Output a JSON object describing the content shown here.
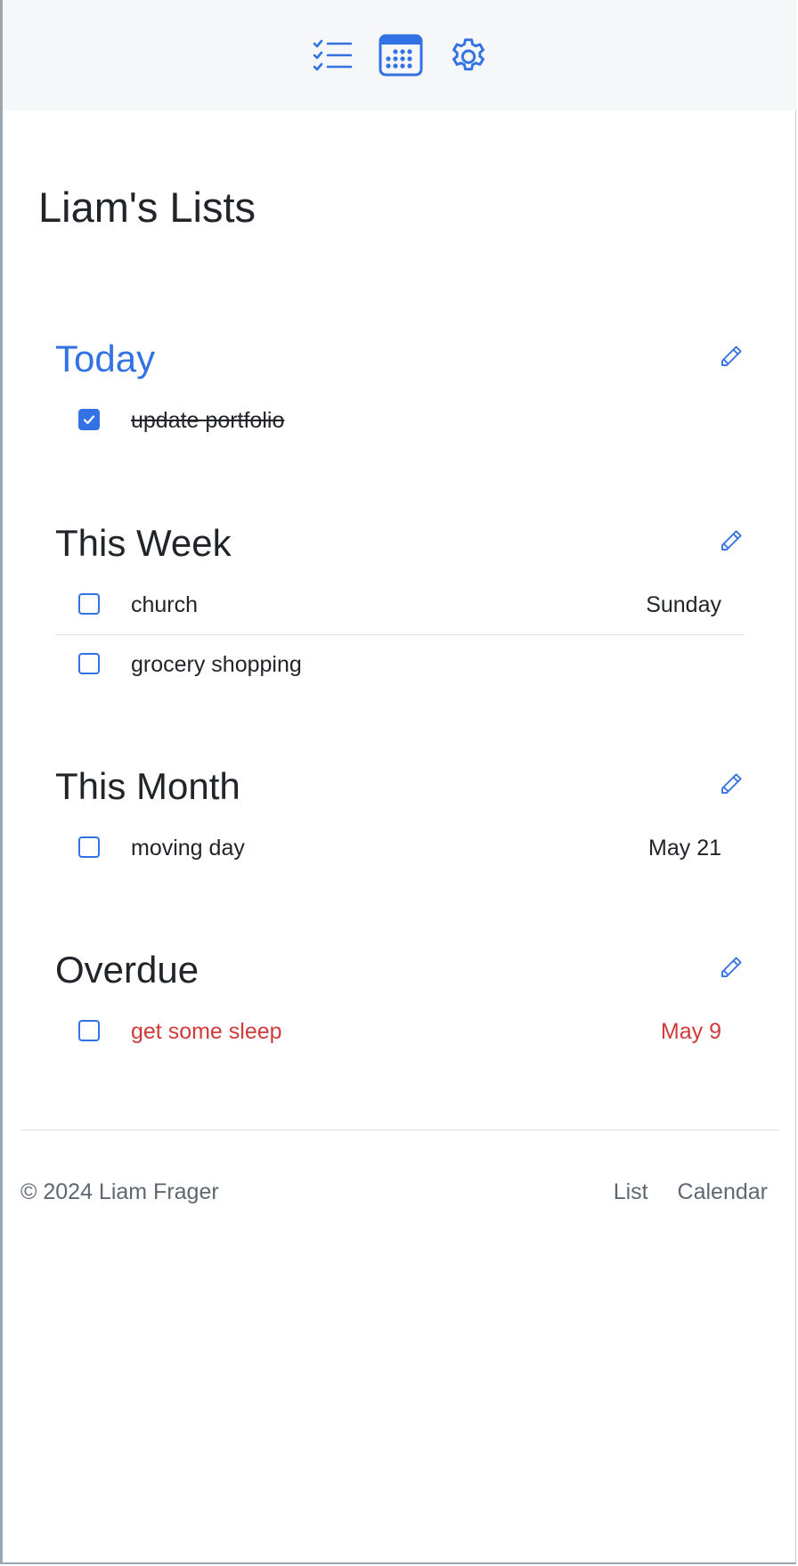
{
  "nav": {
    "items": [
      {
        "icon": "list-check-icon",
        "label": ""
      },
      {
        "icon": "calendar-icon",
        "label": ""
      },
      {
        "icon": "gear-icon",
        "label": ""
      }
    ],
    "accent_color": "#3272e4"
  },
  "page": {
    "title": "Liam's Lists"
  },
  "sections": [
    {
      "title": "Today",
      "active": true,
      "tasks": [
        {
          "label": "update portfolio",
          "date": "",
          "checked": true
        }
      ]
    },
    {
      "title": "This Week",
      "tasks": [
        {
          "label": "church",
          "date": "Sunday",
          "checked": false
        },
        {
          "label": "grocery shopping",
          "date": "",
          "checked": false
        }
      ]
    },
    {
      "title": "This Month",
      "tasks": [
        {
          "label": "moving day",
          "date": "May 21",
          "checked": false
        }
      ]
    },
    {
      "title": "Overdue",
      "tasks": [
        {
          "label": "get some sleep",
          "date": "May 9",
          "checked": false,
          "overdue": true
        }
      ]
    }
  ],
  "footer": {
    "copyright": "© 2024 Liam Frager",
    "links": [
      "List",
      "Calendar"
    ]
  },
  "colors": {
    "accent": "#3272e4",
    "overdue": "#d13a3a",
    "navbar_bg": "#f6f7f9"
  }
}
